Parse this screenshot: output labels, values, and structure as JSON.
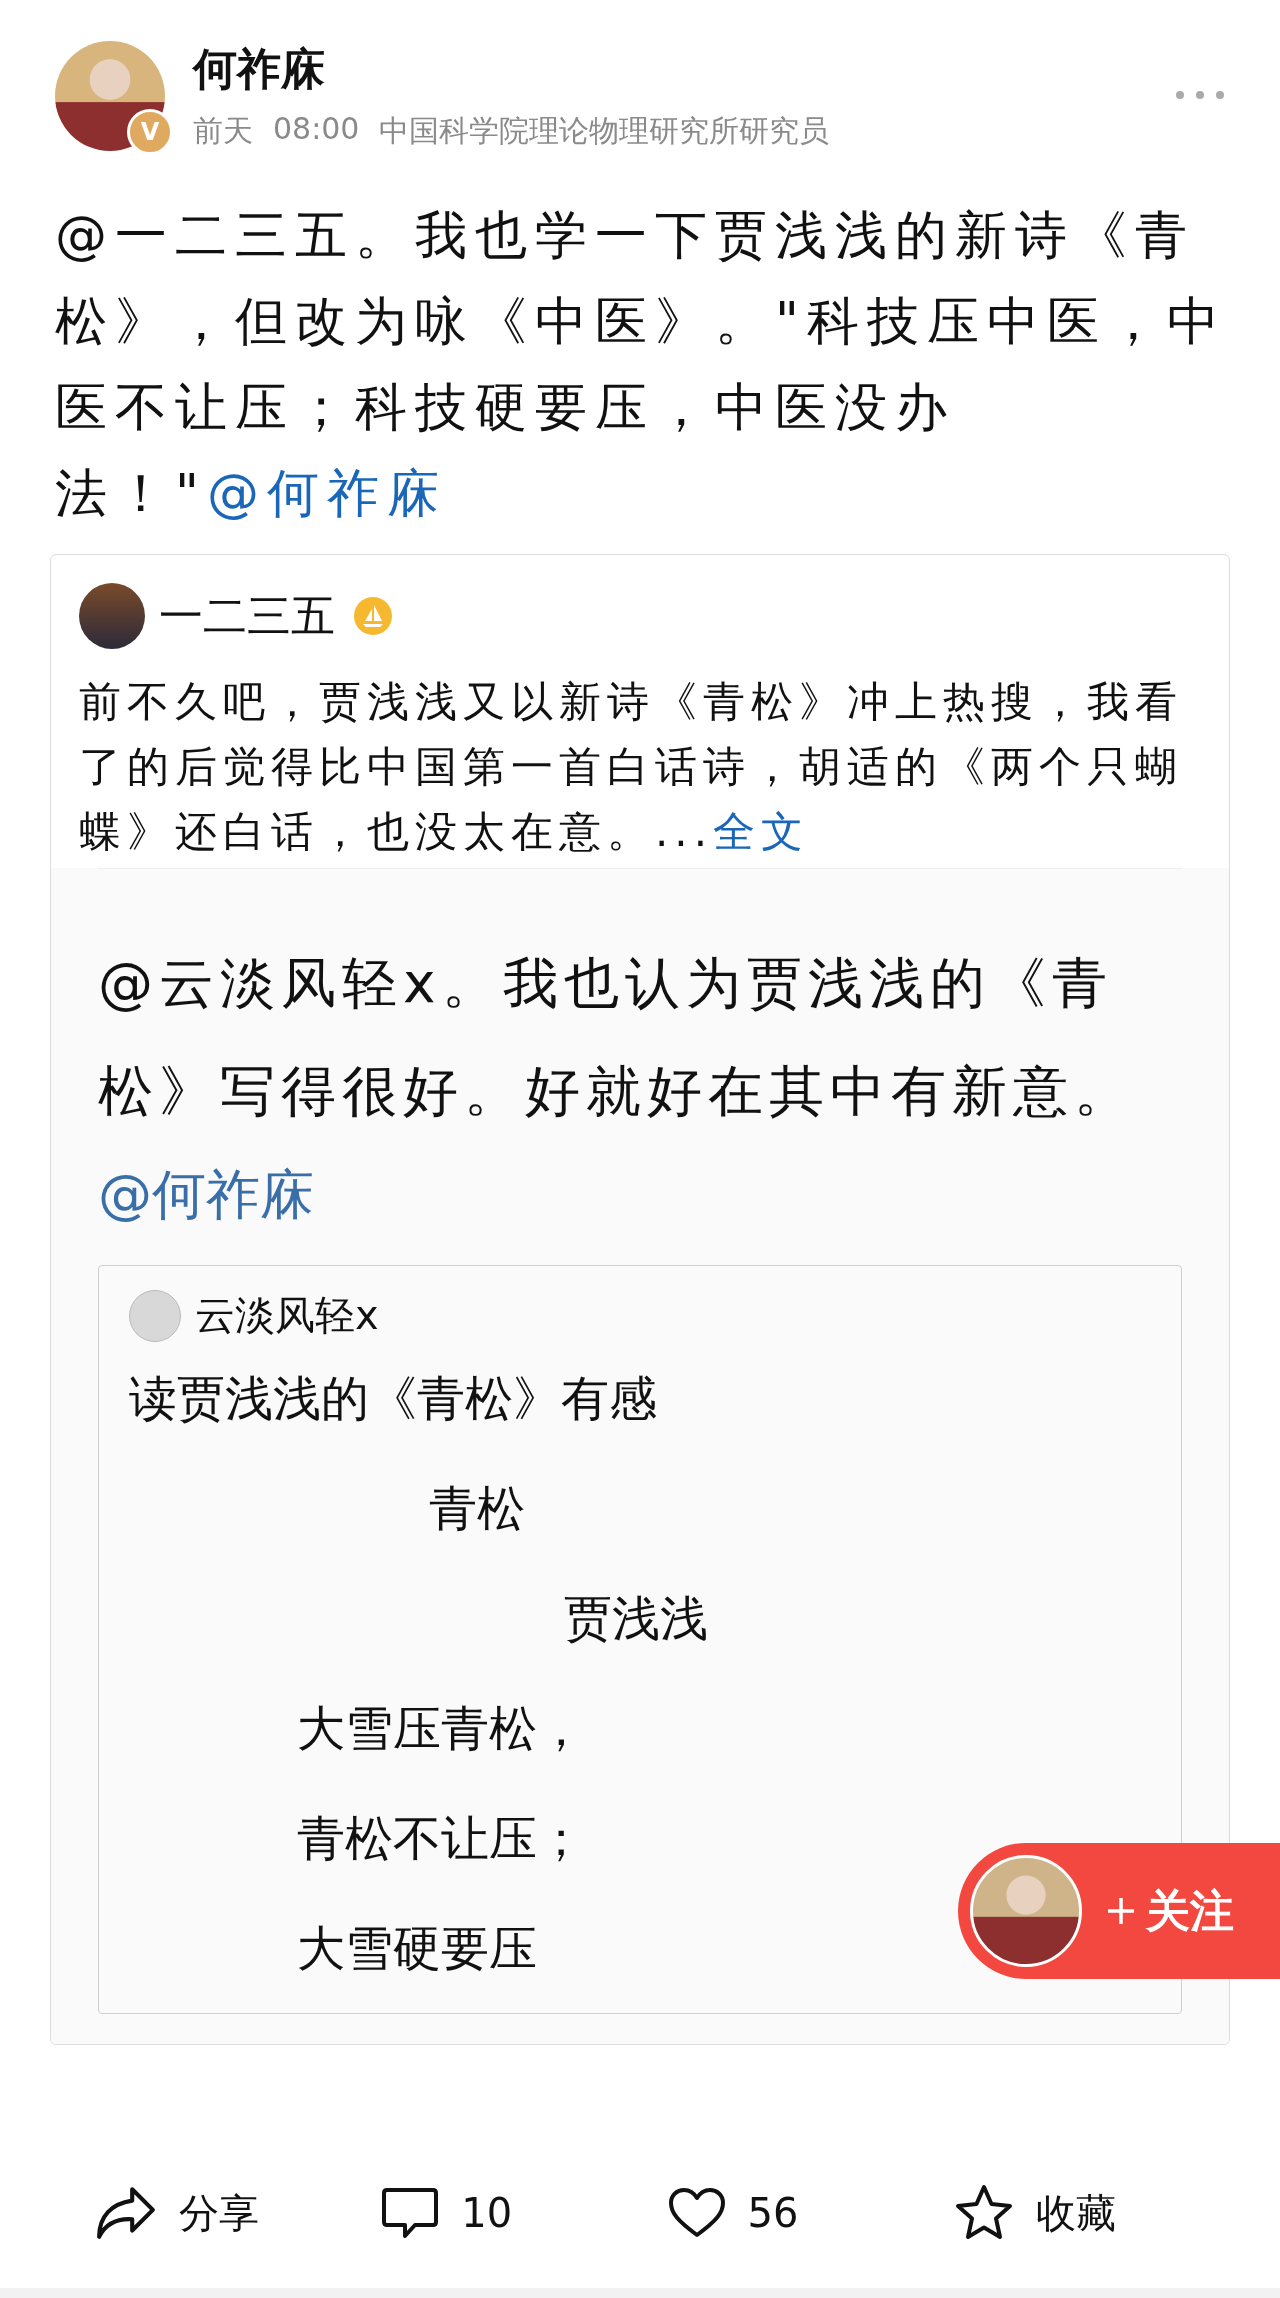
{
  "post": {
    "author": "何祚庥",
    "badge": "V",
    "time": "前天",
    "clock": "08:00",
    "bio": "中国科学院理论物理研究所研究员",
    "text": "@一二三五。我也学一下贾浅浅的新诗《青松》，但改为咏《中医》。\"科技压中医，中医不让压；科技硬要压，中医没办法！\"",
    "mention": "@何祚庥"
  },
  "quote": {
    "author": "一二三五",
    "text": "前不久吧，贾浅浅又以新诗《青松》冲上热搜，我看了的后觉得比中国第一首白话诗，胡适的《两个只蝴蝶》还白话，也没太在意。...",
    "more": "全文",
    "screenshot": {
      "text": "@云淡风轻x。我也认为贾浅浅的《青松》写得很好。好就好在其中有新意。",
      "mention": "@何祚庥",
      "card": {
        "author": "云淡风轻x",
        "lines": [
          {
            "kind": "title",
            "text": "读贾浅浅的《青松》有感"
          },
          {
            "kind": "poem-title",
            "text": "青松"
          },
          {
            "kind": "poet",
            "text": "贾浅浅"
          },
          {
            "kind": "verse",
            "text": "大雪压青松，"
          },
          {
            "kind": "verse",
            "text": "青松不让压；"
          },
          {
            "kind": "verse",
            "text": "大雪硬要压"
          }
        ]
      }
    }
  },
  "follow": {
    "label": "关注"
  },
  "actions": [
    {
      "kind": "share",
      "label": "分享"
    },
    {
      "kind": "comment",
      "label": "10"
    },
    {
      "kind": "like",
      "label": "56"
    },
    {
      "kind": "favorite",
      "label": "收藏"
    }
  ]
}
